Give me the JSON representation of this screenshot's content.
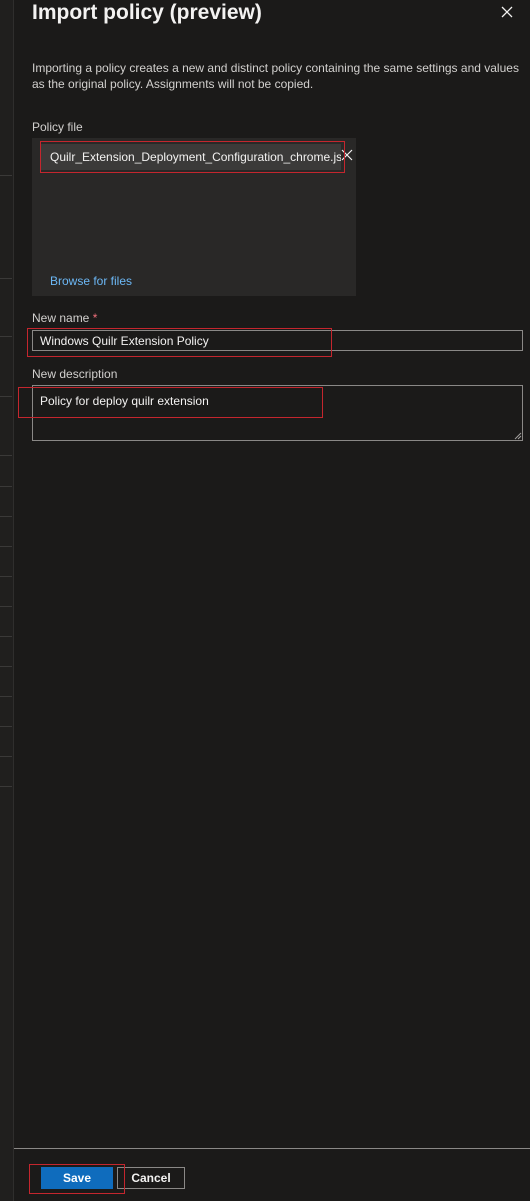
{
  "panel": {
    "title": "Import policy (preview)",
    "description": "Importing a policy creates a new and distinct policy containing the same settings and values as the original policy. Assignments will not be copied."
  },
  "policy_file": {
    "label": "Policy file",
    "file_name": "Quilr_Extension_Deployment_Configuration_chrome.json",
    "browse_label": "Browse for files"
  },
  "new_name": {
    "label": "New name",
    "required_marker": "*",
    "value": "Windows Quilr Extension Policy"
  },
  "new_description": {
    "label": "New description",
    "value": "Policy for deploy quilr extension"
  },
  "footer": {
    "save_label": "Save",
    "cancel_label": "Cancel"
  },
  "colors": {
    "background": "#1b1a19",
    "accent": "#0f6cbd",
    "link": "#6cb8f6",
    "highlight": "#c4262e"
  },
  "icons": {
    "close": "close-icon",
    "remove_file": "remove-file-icon"
  }
}
